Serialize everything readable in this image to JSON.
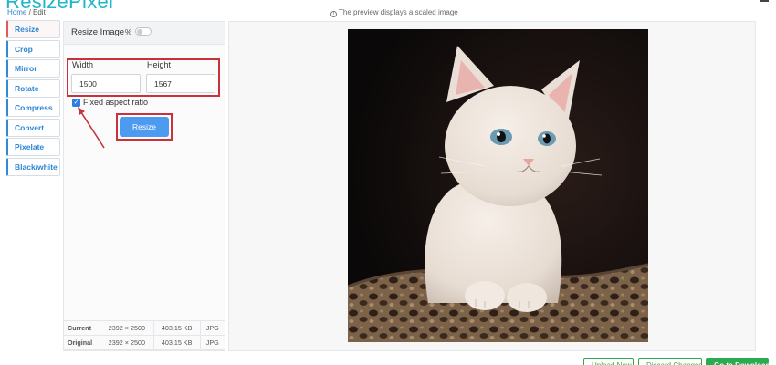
{
  "header": {
    "brand": "ResizePixel",
    "breadcrumb": {
      "home": "Home",
      "separator": " / ",
      "current": "Edit"
    },
    "preview_note": "The preview displays a scaled image"
  },
  "tools": [
    {
      "label": "Resize",
      "active": true
    },
    {
      "label": "Crop"
    },
    {
      "label": "Mirror"
    },
    {
      "label": "Rotate"
    },
    {
      "label": "Compress"
    },
    {
      "label": "Convert"
    },
    {
      "label": "Pixelate"
    },
    {
      "label": "Black/white"
    }
  ],
  "resize_panel": {
    "title": "Resize Image",
    "percent_label": "%",
    "percent_mode": false,
    "width_label": "Width",
    "width_value": "1500",
    "height_label": "Height",
    "height_value": "1567",
    "aspect_label": "Fixed aspect ratio",
    "aspect_checked": true,
    "button_label": "Resize"
  },
  "image_info": {
    "rows": [
      {
        "label": "Current",
        "dimensions": "2392 × 2500",
        "size": "403.15 KB",
        "format": "JPG"
      },
      {
        "label": "Original",
        "dimensions": "2392 × 2500",
        "size": "403.15 KB",
        "format": "JPG"
      }
    ]
  },
  "actions": {
    "upload": "Upload New",
    "discard": "Discard Changes",
    "download": "Go to Download"
  },
  "colors": {
    "brand": "#1fb6c9",
    "link": "#2c86d6",
    "highlight": "#c9323a",
    "primary_button": "#4d9bf0",
    "success": "#2bab4f"
  }
}
